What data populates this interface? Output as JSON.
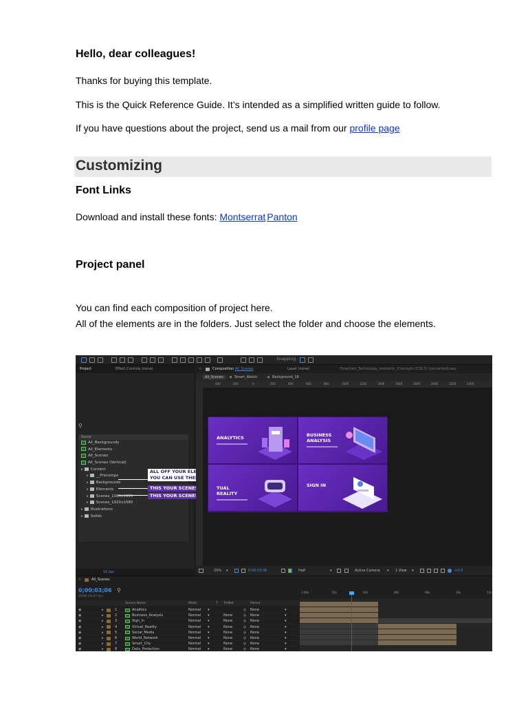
{
  "doc": {
    "greeting": "Hello, dear colleagues!",
    "line1": "Thanks for buying this template.",
    "line2": "This is the Quick Reference Guide. It’s intended as a simplified written guide to follow.",
    "line3_prefix": "If you have questions about the project, send us a mail from our ",
    "line3_link": "profile page",
    "section_title": "Customizing",
    "font_links_heading": "Font Links",
    "font_links_prefix": "Download and install these fonts: ",
    "font_link_1": "Montserrat",
    "font_link_2": "Panton",
    "project_panel_heading": "Project panel",
    "project_line1": "You can find each composition of project here.",
    "project_line2": "All of the elements are in the folders. Just select the folder and choose the elements."
  },
  "screenshot": {
    "toolbar": {
      "snapping_label": "Snapping"
    },
    "project_panel": {
      "tab_project": "Project",
      "tab_effect_controls": "Effect Controls (none)",
      "column_name": "Name",
      "items": [
        {
          "label": "All_Backgrounds",
          "kind": "comp",
          "indent": 0
        },
        {
          "label": "All_Elements",
          "kind": "comp",
          "indent": 0
        },
        {
          "label": "All_Scenes",
          "kind": "comp",
          "indent": 0
        },
        {
          "label": "All_Scenes (Vertical)",
          "kind": "comp",
          "indent": 0
        },
        {
          "label": "Content",
          "kind": "folder",
          "indent": 0
        },
        {
          "label": "__Precomps",
          "kind": "folder",
          "indent": 1
        },
        {
          "label": "Backgrounds",
          "kind": "folder",
          "indent": 1
        },
        {
          "label": "Elements",
          "kind": "folder",
          "indent": 1
        },
        {
          "label": "Scenes_1080x1920",
          "kind": "folder",
          "indent": 1
        },
        {
          "label": "Scenes_1920x1080",
          "kind": "folder",
          "indent": 1
        },
        {
          "label": "Illustrations",
          "kind": "folder",
          "indent": 0
        },
        {
          "label": "Solids",
          "kind": "folder",
          "indent": 0
        }
      ],
      "footer_bpc": "16 bpc"
    },
    "callouts": {
      "elements_1": "ALL OFF YOUR ELEMENTS ARE HERE",
      "elements_2": "YOU CAN USE THEM IN YOUR SCENES",
      "mobile": "THIS YOUR SCENES FOLDER FOR MOBILE",
      "pc": "THIS YOUR SCENES FOLDER FOR PC"
    },
    "composition": {
      "tab_composition": "Composition",
      "tab_comp_name": "All_Scenes",
      "tab_layer": "Layer (none)",
      "tab_file": "Flowchart_Technology_Isometric_iConcepts (CS5.5) (converted).aep",
      "breadcrumb": [
        "All_Scenes",
        "Smart_Watch",
        "Background_18"
      ],
      "footer": {
        "zoom": "25%",
        "timecode": "0;00;03;06",
        "quality": "Half",
        "camera": "Active Camera",
        "view": "1 View",
        "exposure": "+0.0"
      },
      "tiles": [
        {
          "label_1": "ANALYTICS",
          "label_2": ""
        },
        {
          "label_1": "BUSINESS",
          "label_2": "ANALYSIS"
        },
        {
          "label_1": "TUAL",
          "label_2": "REALITY"
        },
        {
          "label_1": "SIGN IN",
          "label_2": ""
        }
      ],
      "canvas_color": "#4a1c8f"
    },
    "timeline": {
      "comp_name": "All_Scenes",
      "timecode": "0;00;03;06",
      "fps": "00096 (29.97 fps)",
      "headers": {
        "source_name": "Source Name",
        "mode": "Mode",
        "t": "T",
        "trkmat": "TrkMat",
        "parent": "Parent"
      },
      "ruler": [
        "1:00s",
        "02s",
        "04s",
        "06s",
        "08s",
        "10s",
        "12s"
      ],
      "layers": [
        {
          "num": "1",
          "name": "Analitics",
          "mode": "Normal",
          "trkmat": "",
          "parent": "None"
        },
        {
          "num": "2",
          "name": "Business_Analysis",
          "mode": "Normal",
          "trkmat": "None",
          "parent": "None"
        },
        {
          "num": "3",
          "name": "Sign_in",
          "mode": "Normal",
          "trkmat": "None",
          "parent": "None"
        },
        {
          "num": "4",
          "name": "Virtual_Reality",
          "mode": "Normal",
          "trkmat": "None",
          "parent": "None"
        },
        {
          "num": "5",
          "name": "Social_Media",
          "mode": "Normal",
          "trkmat": "None",
          "parent": "None"
        },
        {
          "num": "6",
          "name": "World_Network",
          "mode": "Normal",
          "trkmat": "None",
          "parent": "None"
        },
        {
          "num": "7",
          "name": "Smart_City",
          "mode": "Normal",
          "trkmat": "None",
          "parent": "None"
        },
        {
          "num": "8",
          "name": "Data_Protection",
          "mode": "Normal",
          "trkmat": "None",
          "parent": "None"
        }
      ]
    }
  }
}
